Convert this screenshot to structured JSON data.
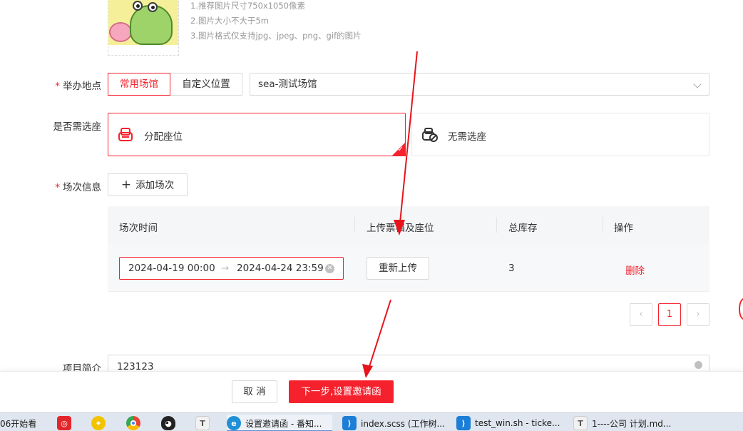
{
  "poster": {
    "tips": [
      "1.推荐图片尺寸750x1050像素",
      "2.图片大小不大于5m",
      "3.图片格式仅支持jpg、jpeg、png、gif的图片"
    ]
  },
  "venue": {
    "label": "举办地点",
    "tabs": [
      {
        "label": "常用场馆",
        "active": true
      },
      {
        "label": "自定义位置",
        "active": false
      }
    ],
    "selected": "sea-测试场馆"
  },
  "seat_select": {
    "label": "是否需选座",
    "options": [
      {
        "label": "分配座位",
        "active": true
      },
      {
        "label": "无需选座",
        "active": false
      }
    ]
  },
  "sessions": {
    "label": "场次信息",
    "add_button": "添加场次",
    "columns": [
      "场次时间",
      "上传票档及座位",
      "总库存",
      "操作"
    ],
    "rows": [
      {
        "start": "2024-04-19 00:00",
        "end": "2024-04-24 23:59",
        "upload_button": "重新上传",
        "stock": "3",
        "action": "删除"
      }
    ],
    "pagination": {
      "prev": "‹",
      "current": "1",
      "next": "›"
    }
  },
  "intro": {
    "label": "项目简介",
    "value": "123123"
  },
  "footer": {
    "cancel": "取 消",
    "next": "下一步,设置邀请函"
  },
  "taskbar": {
    "items": [
      {
        "label": "06开始看"
      },
      {
        "label": "设置邀请函 - 番知..."
      },
      {
        "label": "index.scss (工作树..."
      },
      {
        "label": "test_win.sh - ticke..."
      },
      {
        "label": "1----公司 计划.md..."
      }
    ]
  },
  "colors": {
    "accent": "#f5222d",
    "border": "#d9d9d9",
    "table_header": "#f5f6f8"
  }
}
